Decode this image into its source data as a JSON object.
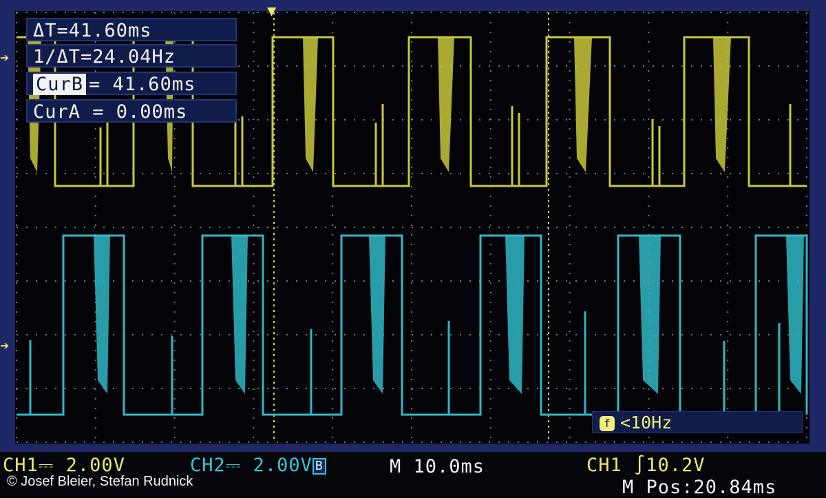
{
  "cursor_readouts": {
    "delta_t": "ΔT=41.60ms",
    "inv_delta_t": "1/ΔT=24.04Hz",
    "cur_b_label": "CurB",
    "cur_b_value": "= 41.60ms",
    "cur_a": "CurA = 0.00ms"
  },
  "trigger_frequency": {
    "icon": "f",
    "text": "<10Hz"
  },
  "status_bar": {
    "ch1_scale": "CH1⎓ 2.00V",
    "ch2_scale": "CH2⎓ 2.00V",
    "ch2_bw_badge": "B",
    "timebase": "M 10.0ms",
    "trigger": "CH1 ∫10.2V",
    "position": "M Pos:20.84ms"
  },
  "copyright": "© Josef Bleier, Stefan Rudnick",
  "colors": {
    "ch1_trace": "#c8c83a",
    "ch2_trace": "#2fb8c6",
    "grid": "#9aa0c8",
    "cursor": "#d8d05a",
    "background": "#040408",
    "panel": "#101c4a",
    "frame": "#1e2866"
  },
  "icons": {
    "trigger_marker": "trigger-arrow-down",
    "ch1_level": "ch1-level-arrow-right",
    "ch2_level": "ch2-level-arrow-right",
    "frequency": "frequency-icon"
  }
}
